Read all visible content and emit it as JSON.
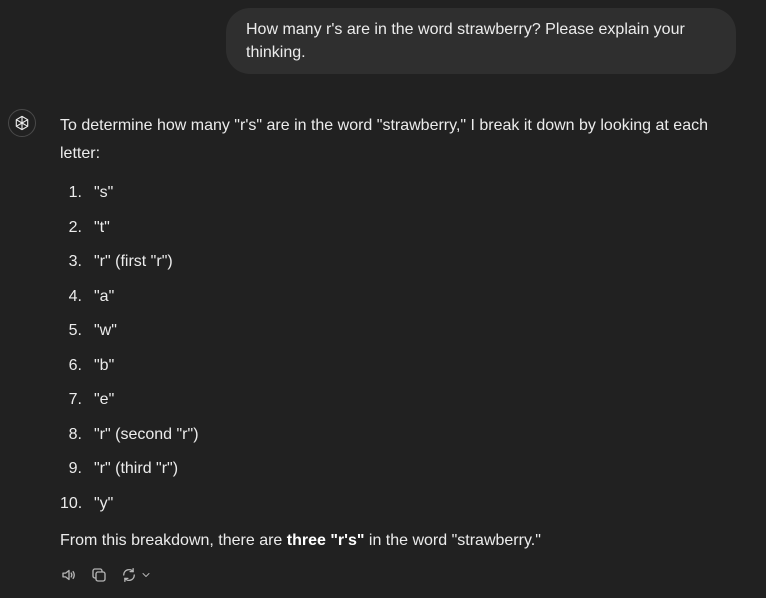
{
  "user_message": "How many r's are in the word strawberry? Please explain your thinking.",
  "assistant": {
    "intro": "To determine how many \"r's\" are in the word \"strawberry,\" I break it down by looking at each letter:",
    "steps": [
      {
        "num": "1.",
        "text": "\"s\""
      },
      {
        "num": "2.",
        "text": "\"t\""
      },
      {
        "num": "3.",
        "text": "\"r\" (first \"r\")"
      },
      {
        "num": "4.",
        "text": "\"a\""
      },
      {
        "num": "5.",
        "text": "\"w\""
      },
      {
        "num": "6.",
        "text": "\"b\""
      },
      {
        "num": "7.",
        "text": "\"e\""
      },
      {
        "num": "8.",
        "text": "\"r\" (second \"r\")"
      },
      {
        "num": "9.",
        "text": "\"r\" (third \"r\")"
      },
      {
        "num": "10.",
        "text": "\"y\""
      }
    ],
    "conclusion_pre": "From this breakdown, there are ",
    "conclusion_bold": "three \"r's\"",
    "conclusion_post": " in the word \"strawberry.\""
  },
  "icons": {
    "avatar": "openai-logo-icon",
    "read_aloud": "speaker-icon",
    "copy": "copy-icon",
    "regenerate": "regenerate-icon",
    "model_menu": "chevron-down-icon"
  }
}
